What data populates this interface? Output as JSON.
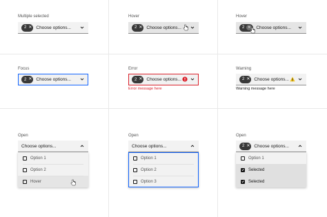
{
  "colors": {
    "field_bg": "#f2f2f2",
    "focus": "#0f62fe",
    "error": "#da1e28",
    "warning": "#f1c21b",
    "tag_bg": "#393939"
  },
  "cells": {
    "multiple_selected": {
      "label": "Multiple selected",
      "tag_count": "2",
      "placeholder": "Choose options..."
    },
    "hover_1": {
      "label": "Hover",
      "tag_count": "2",
      "placeholder": "Choose options..."
    },
    "hover_2": {
      "label": "Hover",
      "tag_count": "2",
      "placeholder": "Choose options..."
    },
    "focus": {
      "label": "Focus",
      "tag_count": "2",
      "placeholder": "Choose options..."
    },
    "error": {
      "label": "Error",
      "tag_count": "2",
      "placeholder": "Choose options...",
      "helper": "Error message here"
    },
    "warning": {
      "label": "Warning",
      "tag_count": "2",
      "placeholder": "Choose options...",
      "helper": "Warning message here"
    },
    "open_1": {
      "label": "Open",
      "placeholder": "Choose options...",
      "options": [
        "Option 1",
        "Option 2",
        "Hover"
      ]
    },
    "open_2": {
      "label": "Open",
      "placeholder": "Choose options...",
      "options": [
        "Option 1",
        "Option 2",
        "Option 3"
      ]
    },
    "open_3": {
      "label": "Open",
      "tag_count": "2",
      "placeholder": "Choose options...",
      "options": [
        "Option 1",
        "Selected",
        "Selected"
      ]
    }
  }
}
